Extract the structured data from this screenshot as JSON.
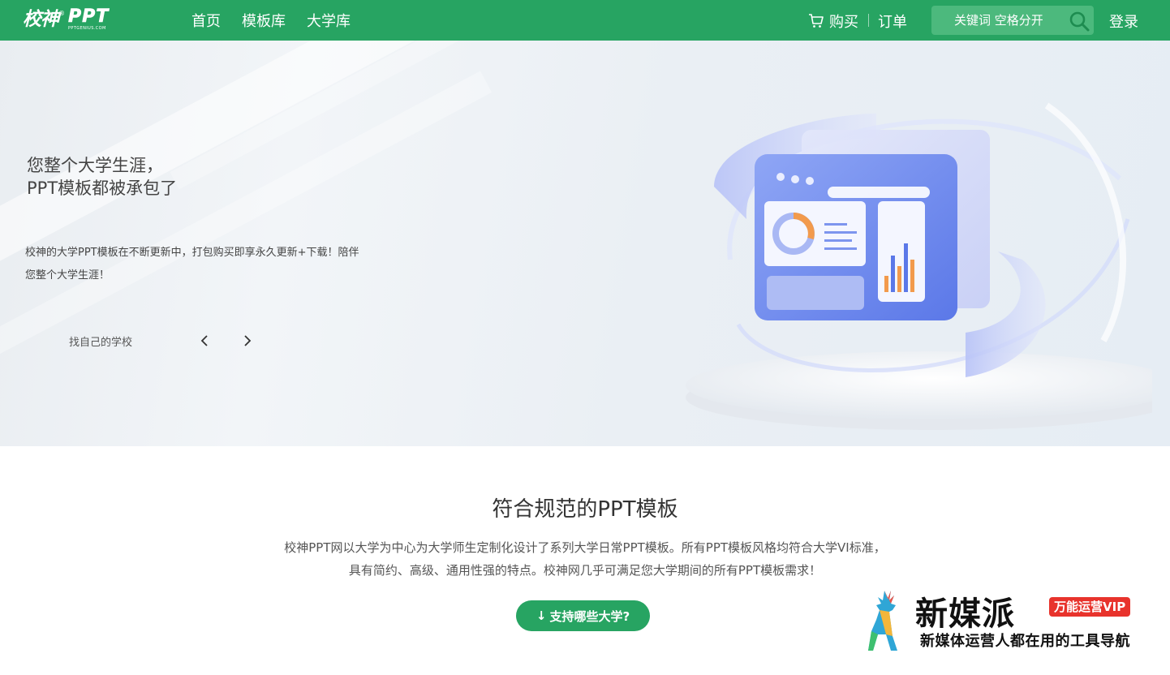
{
  "brand": {
    "logo_cn": "校神",
    "logo_en": "PPT",
    "logo_reg": "®",
    "logo_sub": "PPTGENIUS.COM"
  },
  "nav": {
    "items": [
      {
        "label": "首页"
      },
      {
        "label": "模板库"
      },
      {
        "label": "大学库"
      }
    ]
  },
  "header": {
    "cart_label": "购买",
    "orders_label": "订单",
    "search_placeholder": "关键词 空格分开",
    "login_label": "登录"
  },
  "hero": {
    "title_line1": "您整个大学生涯，",
    "title_line2": "PPT模板都被承包了",
    "desc_line1": "校神的大学PPT模板在不断更新中，打包购买即享永久更新+下载！陪伴",
    "desc_line2": "您整个大学生涯！",
    "find_label": "找自己的学校"
  },
  "section": {
    "title": "符合规范的PPT模板",
    "para_line1": "校神PPT网以大学为中心为大学师生定制化设计了系列大学日常PPT模板。所有PPT模板风格均符合大学VI标准，",
    "para_line2": "具有简约、高级、通用性强的特点。校神网几乎可满足您大学期间的所有PPT模板需求！",
    "cta_arrow": "↓",
    "cta_label": "支持哪些大学?"
  },
  "watermark": {
    "title": "新媒派",
    "badge": "万能运营VIP",
    "subtitle": "新媒体运营人都在用的工具导航"
  },
  "colors": {
    "brand_green": "#27a462",
    "search_bg": "#4cb97d",
    "badge_red": "#e8332c"
  }
}
